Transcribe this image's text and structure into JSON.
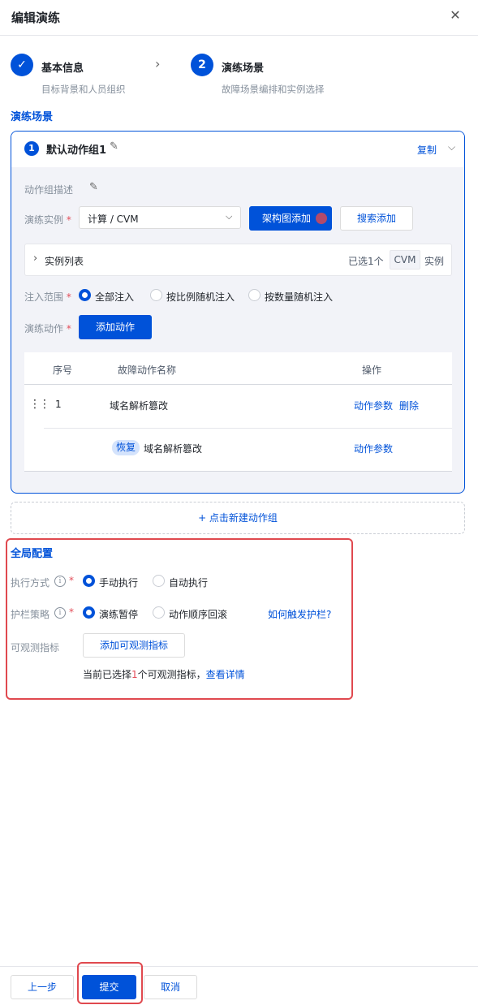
{
  "dialog": {
    "title": "编辑演练"
  },
  "steps": [
    {
      "num": "✓",
      "title": "基本信息",
      "sub": "目标背景和人员组织"
    },
    {
      "num": "2",
      "title": "演练场景",
      "sub": "故障场景编排和实例选择"
    }
  ],
  "scenario": {
    "section_title": "演练场景",
    "group": {
      "index": "1",
      "name": "默认动作组1",
      "copy_label": "复制",
      "desc_label": "动作组描述",
      "instance_label": "演练实例",
      "instance_value": "计算 / CVM",
      "arch_add_label": "架构图添加",
      "search_add_label": "搜索添加",
      "instance_list_label": "实例列表",
      "selected_prefix": "已选",
      "selected_count": "1个",
      "selected_type": "CVM",
      "selected_suffix": "实例",
      "inject_label": "注入范围",
      "inject_options": [
        "全部注入",
        "按比例随机注入",
        "按数量随机注入"
      ],
      "action_label": "演练动作",
      "add_action_label": "添加动作",
      "table": {
        "headers": [
          "序号",
          "故障动作名称",
          "操作"
        ],
        "rows": [
          {
            "index": "1",
            "name": "域名解析篡改",
            "ops": [
              "动作参数",
              "删除"
            ]
          },
          {
            "tag": "恢复",
            "name": "域名解析篡改",
            "ops": [
              "动作参数"
            ]
          }
        ]
      }
    },
    "new_group_label": "+ 点击新建动作组"
  },
  "global": {
    "section_title": "全局配置",
    "exec_label": "执行方式",
    "exec_options": [
      "手动执行",
      "自动执行"
    ],
    "guard_label": "护栏策略",
    "guard_options": [
      "演练暂停",
      "动作顺序回滚"
    ],
    "guard_link": "如何触发护栏?",
    "metric_label": "可观测指标",
    "metric_button": "添加可观测指标",
    "metric_prefix": "当前已选择",
    "metric_count": "1",
    "metric_suffix": "个可观测指标，",
    "metric_link": "查看详情"
  },
  "footer": {
    "prev": "上一步",
    "submit": "提交",
    "cancel": "取消"
  },
  "colors": {
    "primary": "#0052d9",
    "highlight": "#e0494f",
    "required": "#e34d59"
  }
}
